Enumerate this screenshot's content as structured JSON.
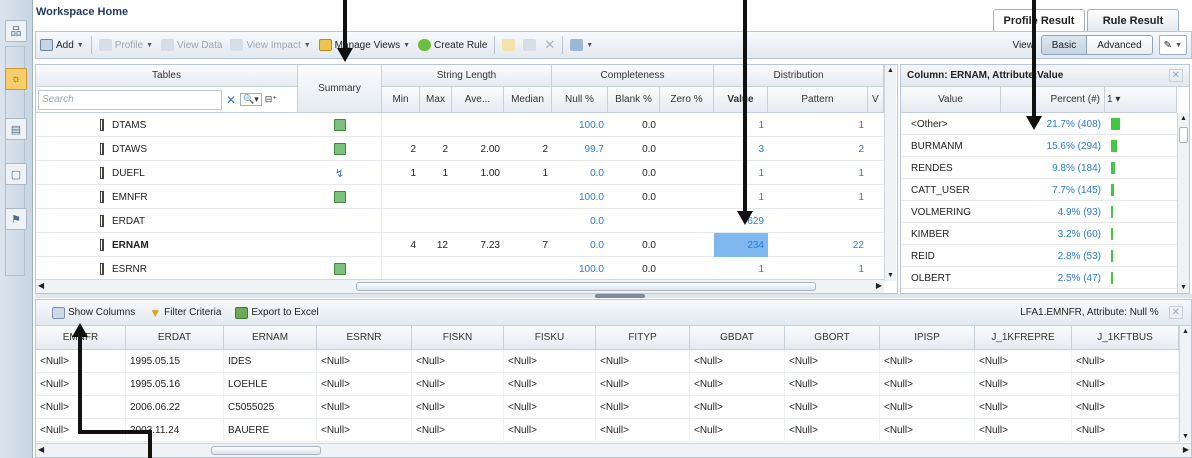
{
  "workspace": {
    "title": "Workspace Home"
  },
  "right_tabs": [
    "Profile Result",
    "Rule Result"
  ],
  "toolbar": {
    "add": "Add",
    "profile": "Profile",
    "view_data": "View Data",
    "view_impact": "View Impact",
    "manage_views": "Manage Views",
    "create_rule": "Create Rule",
    "view_label": "View:",
    "basic": "Basic",
    "advanced": "Advanced"
  },
  "top_grid": {
    "group_headers": [
      "Tables",
      "Summary",
      "String Length",
      "Completeness",
      "Distribution"
    ],
    "sub_headers": [
      "Min",
      "Max",
      "Ave...",
      "Median",
      "Null %",
      "Blank %",
      "Zero %",
      "Value",
      "Pattern",
      "V"
    ],
    "search_placeholder": "Search",
    "rows": [
      {
        "name": "DTAMS",
        "summary": "green",
        "min": "",
        "max": "",
        "ave": "",
        "median": "",
        "null": "100.0",
        "blank": "0.0",
        "zero": "",
        "value": "1",
        "pattern": "1"
      },
      {
        "name": "DTAWS",
        "summary": "green",
        "min": "2",
        "max": "2",
        "ave": "2.00",
        "median": "2",
        "null": "99.7",
        "blank": "0.0",
        "zero": "",
        "value": "3",
        "pattern": "2"
      },
      {
        "name": "DUEFL",
        "summary": "bolt",
        "min": "1",
        "max": "1",
        "ave": "1.00",
        "median": "1",
        "null": "0.0",
        "blank": "0.0",
        "zero": "",
        "value": "1",
        "pattern": "1"
      },
      {
        "name": "EMNFR",
        "summary": "green",
        "min": "",
        "max": "",
        "ave": "",
        "median": "",
        "null": "100.0",
        "blank": "0.0",
        "zero": "",
        "value": "1",
        "pattern": "1"
      },
      {
        "name": "ERDAT",
        "summary": "",
        "min": "",
        "max": "",
        "ave": "",
        "median": "",
        "null": "0.0",
        "blank": "",
        "zero": "",
        "value": "629",
        "pattern": ""
      },
      {
        "name": "ERNAM",
        "summary": "",
        "min": "4",
        "max": "12",
        "ave": "7.23",
        "median": "7",
        "null": "0.0",
        "blank": "0.0",
        "zero": "",
        "value": "234",
        "pattern": "22"
      },
      {
        "name": "ESRNR",
        "summary": "green",
        "min": "",
        "max": "",
        "ave": "",
        "median": "",
        "null": "100.0",
        "blank": "0.0",
        "zero": "",
        "value": "1",
        "pattern": "1"
      }
    ]
  },
  "column_panel": {
    "title": "Column: ERNAM, Attribute:Value",
    "headers": [
      "Value",
      "Percent (#)",
      "1 ▾"
    ],
    "rows": [
      {
        "value": "<Other>",
        "pct": "21.7% (408)",
        "frac": 0.217
      },
      {
        "value": "BURMANM",
        "pct": "15.6% (294)",
        "frac": 0.156
      },
      {
        "value": "RENDES",
        "pct": "9.8% (184)",
        "frac": 0.098
      },
      {
        "value": "CATT_USER",
        "pct": "7.7% (145)",
        "frac": 0.077
      },
      {
        "value": "VOLMERING",
        "pct": "4.9% (93)",
        "frac": 0.049
      },
      {
        "value": "KIMBER",
        "pct": "3.2% (60)",
        "frac": 0.032
      },
      {
        "value": "REID",
        "pct": "2.8% (53)",
        "frac": 0.028
      },
      {
        "value": "OLBERT",
        "pct": "2.5% (47)",
        "frac": 0.025
      }
    ]
  },
  "bottom": {
    "show_columns": "Show Columns",
    "filter_criteria": "Filter Criteria",
    "export": "Export to Excel",
    "info": "LFA1.EMNFR, Attribute: Null %",
    "headers": [
      "EMNFR",
      "ERDAT",
      "ERNAM",
      "ESRNR",
      "FISKN",
      "FISKU",
      "FITYP",
      "GBDAT",
      "GBORT",
      "IPISP",
      "J_1KFREPRE",
      "J_1KFTBUS"
    ],
    "rows": [
      [
        "<Null>",
        "1995.05.15",
        "IDES",
        "<Null>",
        "<Null>",
        "<Null>",
        "<Null>",
        "<Null>",
        "<Null>",
        "<Null>",
        "<Null>",
        "<Null>"
      ],
      [
        "<Null>",
        "1995.05.16",
        "LOEHLE",
        "<Null>",
        "<Null>",
        "<Null>",
        "<Null>",
        "<Null>",
        "<Null>",
        "<Null>",
        "<Null>",
        "<Null>"
      ],
      [
        "<Null>",
        "2006.06.22",
        "C5055025",
        "<Null>",
        "<Null>",
        "<Null>",
        "<Null>",
        "<Null>",
        "<Null>",
        "<Null>",
        "<Null>",
        "<Null>"
      ],
      [
        "<Null>",
        "2003.11.24",
        "BAUERE",
        "<Null>",
        "<Null>",
        "<Null>",
        "<Null>",
        "<Null>",
        "<Null>",
        "<Null>",
        "<Null>",
        "<Null>"
      ]
    ]
  },
  "colors": {
    "accent_blue": "#2a7bd8",
    "highlight": "#7fb8ef",
    "bar_green": "#43c843"
  }
}
